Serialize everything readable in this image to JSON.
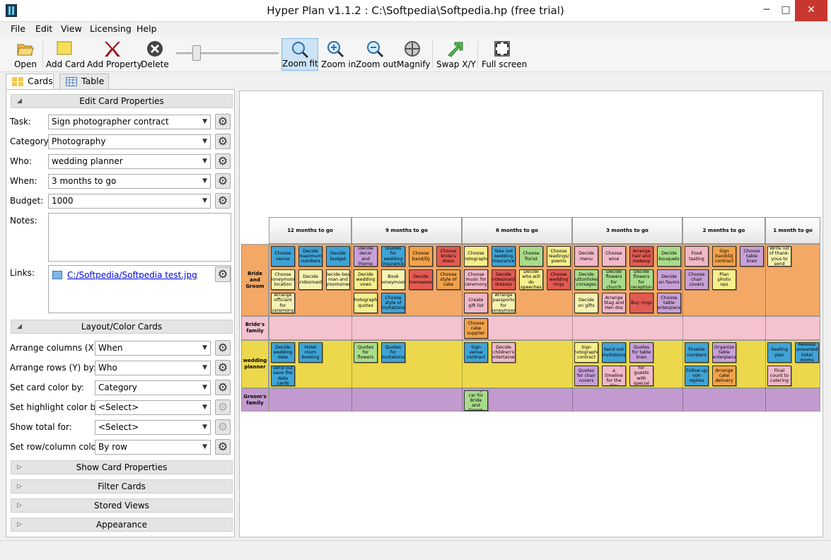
{
  "window": {
    "title": "Hyper Plan v1.1.2 : C:\\Softpedia\\Softpedia.hp (free trial)",
    "minimize": "─",
    "maximize": "□",
    "close": "✕"
  },
  "menu": [
    "File",
    "Edit",
    "View",
    "Licensing",
    "Help"
  ],
  "toolbar": {
    "open": "Open",
    "add_card": "Add Card",
    "add_property": "Add Property",
    "delete": "Delete",
    "zoom_fit": "Zoom fit",
    "zoom_in": "Zoom in",
    "zoom_out": "Zoom out",
    "magnify": "Magnify",
    "swap_xy": "Swap X/Y",
    "full_screen": "Full screen",
    "zoom_slider": 0.2
  },
  "tabs": {
    "cards": "Cards",
    "table": "Table"
  },
  "edit_card": {
    "header": "Edit Card Properties",
    "task_label": "Task:",
    "task": "Sign photographer contract",
    "category_label": "Category:",
    "category": "Photography",
    "who_label": "Who:",
    "who": "wedding planner",
    "when_label": "When:",
    "when": "3 months to go",
    "budget_label": "Budget:",
    "budget": "1000",
    "notes_label": "Notes:",
    "notes": "",
    "links_label": "Links:",
    "link": "C:/Softpedia/Softpedia test.jpg"
  },
  "layout": {
    "header": "Layout/Color Cards",
    "arrange_x_label": "Arrange columns (X) by:",
    "arrange_x": "When",
    "arrange_y_label": "Arrange rows (Y) by:",
    "arrange_y": "Who",
    "card_color_label": "Set card color by:",
    "card_color": "Category",
    "highlight_label": "Set highlight color by:",
    "highlight": "<Select>",
    "total_label": "Show total for:",
    "total": "<Select>",
    "rowcol_label": "Set row/column color:",
    "rowcol": "By row"
  },
  "sections": {
    "show_card": "Show Card Properties",
    "filter": "Filter Cards",
    "stored": "Stored Views",
    "appearance": "Appearance"
  },
  "colors": {
    "blue": "#3fa3d6",
    "pink": "#f0b8c8",
    "yellow": "#f5ef8c",
    "orange": "#f2a24a",
    "red": "#e35a52",
    "purple": "#c8a0d8",
    "green": "#a8dc8a",
    "cream": "#f7f2b0",
    "row_bg": [
      "#f3a866",
      "#f5c2d0",
      "#ecd84a",
      "#c39ad0"
    ]
  },
  "board": {
    "columns": [
      "12 months to go",
      "9 months to go",
      "6 months to go",
      "3 months to go",
      "2 months to go",
      "1 month to go"
    ],
    "rows": [
      "Bride and Groom",
      "Bride's family",
      "wedding planner",
      "Groom's family"
    ],
    "cards": [
      {
        "text": "Choose venue",
        "row": 0,
        "col": 0,
        "slot": 0,
        "line": 0,
        "color": "blue"
      },
      {
        "text": "Decide maximum numbers",
        "row": 0,
        "col": 0,
        "slot": 1,
        "line": 0,
        "color": "blue"
      },
      {
        "text": "Decide budget",
        "row": 0,
        "col": 0,
        "slot": 2,
        "line": 0,
        "color": "blue"
      },
      {
        "text": "Choose honeymoon location",
        "row": 0,
        "col": 0,
        "slot": 0,
        "line": 1,
        "color": "cream"
      },
      {
        "text": "Decide bridesmaids",
        "row": 0,
        "col": 0,
        "slot": 1,
        "line": 1,
        "color": "cream"
      },
      {
        "text": "Decide best man and groomsmen",
        "row": 0,
        "col": 0,
        "slot": 2,
        "line": 1,
        "color": "cream"
      },
      {
        "text": "Arrange officiant for ceremony",
        "row": 0,
        "col": 0,
        "slot": 0,
        "line": 2,
        "color": "cream"
      },
      {
        "text": "Decide decor and theme",
        "row": 0,
        "col": 1,
        "slot": 0,
        "line": 0,
        "color": "purple"
      },
      {
        "text": "Quotes for wedding insurance",
        "row": 0,
        "col": 1,
        "slot": 1,
        "line": 0,
        "color": "blue"
      },
      {
        "text": "Choose band/DJ",
        "row": 0,
        "col": 1,
        "slot": 2,
        "line": 0,
        "color": "orange"
      },
      {
        "text": "Choose bride's dress",
        "row": 0,
        "col": 1,
        "slot": 3,
        "line": 0,
        "color": "red"
      },
      {
        "text": "Decide wedding vows",
        "row": 0,
        "col": 1,
        "slot": 0,
        "line": 1,
        "color": "yellow"
      },
      {
        "text": "Book honeymoon",
        "row": 0,
        "col": 1,
        "slot": 1,
        "line": 1,
        "color": "cream"
      },
      {
        "text": "Decide menswear",
        "row": 0,
        "col": 1,
        "slot": 2,
        "line": 1,
        "color": "red"
      },
      {
        "text": "Choose style of cake",
        "row": 0,
        "col": 1,
        "slot": 3,
        "line": 1,
        "color": "orange"
      },
      {
        "text": "Photography quotes",
        "row": 0,
        "col": 1,
        "slot": 0,
        "line": 2,
        "color": "yellow"
      },
      {
        "text": "Choose style of invitations",
        "row": 0,
        "col": 1,
        "slot": 1,
        "line": 2,
        "color": "blue"
      },
      {
        "text": "Choose photographer",
        "row": 0,
        "col": 2,
        "slot": 0,
        "line": 0,
        "color": "yellow"
      },
      {
        "text": "Take out wedding insurance",
        "row": 0,
        "col": 2,
        "slot": 1,
        "line": 0,
        "color": "blue"
      },
      {
        "text": "Choose florist",
        "row": 0,
        "col": 2,
        "slot": 2,
        "line": 0,
        "color": "green"
      },
      {
        "text": "Choose readings/ poems",
        "row": 0,
        "col": 2,
        "slot": 3,
        "line": 0,
        "color": "yellow"
      },
      {
        "text": "Choose music for ceremony",
        "row": 0,
        "col": 2,
        "slot": 0,
        "line": 1,
        "color": "pink"
      },
      {
        "text": "Decide bridesmaids dresses",
        "row": 0,
        "col": 2,
        "slot": 1,
        "line": 1,
        "color": "red"
      },
      {
        "text": "Decide who will do speeches",
        "row": 0,
        "col": 2,
        "slot": 2,
        "line": 1,
        "color": "yellow"
      },
      {
        "text": "Choose wedding rings",
        "row": 0,
        "col": 2,
        "slot": 3,
        "line": 1,
        "color": "red"
      },
      {
        "text": "Create gift list",
        "row": 0,
        "col": 2,
        "slot": 0,
        "line": 2,
        "color": "pink"
      },
      {
        "text": "Arrange passports for honeymoon",
        "row": 0,
        "col": 2,
        "slot": 1,
        "line": 2,
        "color": "cream"
      },
      {
        "text": "Decide menu",
        "row": 0,
        "col": 3,
        "slot": 0,
        "line": 0,
        "color": "pink"
      },
      {
        "text": "Choose wine",
        "row": 0,
        "col": 3,
        "slot": 1,
        "line": 0,
        "color": "pink"
      },
      {
        "text": "Arrange hair and makeup",
        "row": 0,
        "col": 3,
        "slot": 2,
        "line": 0,
        "color": "red"
      },
      {
        "text": "Decide bouquets",
        "row": 0,
        "col": 3,
        "slot": 3,
        "line": 0,
        "color": "green"
      },
      {
        "text": "Decide buttonholes/ corsages",
        "row": 0,
        "col": 3,
        "slot": 0,
        "line": 1,
        "color": "green"
      },
      {
        "text": "Decide flowers for church",
        "row": 0,
        "col": 3,
        "slot": 1,
        "line": 1,
        "color": "green"
      },
      {
        "text": "Decide flowers for reception",
        "row": 0,
        "col": 3,
        "slot": 2,
        "line": 1,
        "color": "green"
      },
      {
        "text": "Decide on favors",
        "row": 0,
        "col": 3,
        "slot": 3,
        "line": 1,
        "color": "purple"
      },
      {
        "text": "Decide on gifts",
        "row": 0,
        "col": 3,
        "slot": 0,
        "line": 2,
        "color": "cream"
      },
      {
        "text": "Arrange Stag and Hen dos",
        "row": 0,
        "col": 3,
        "slot": 1,
        "line": 2,
        "color": "pink"
      },
      {
        "text": "Buy rings",
        "row": 0,
        "col": 3,
        "slot": 2,
        "line": 2,
        "color": "red"
      },
      {
        "text": "Choose table centerpieces",
        "row": 0,
        "col": 3,
        "slot": 3,
        "line": 2,
        "color": "purple"
      },
      {
        "text": "Food tasting",
        "row": 0,
        "col": 4,
        "slot": 0,
        "line": 0,
        "color": "pink"
      },
      {
        "text": "Sign band/DJ contract",
        "row": 0,
        "col": 4,
        "slot": 1,
        "line": 0,
        "color": "orange"
      },
      {
        "text": "Choose table linen",
        "row": 0,
        "col": 4,
        "slot": 2,
        "line": 0,
        "color": "purple"
      },
      {
        "text": "Choose chair covers",
        "row": 0,
        "col": 4,
        "slot": 0,
        "line": 1,
        "color": "purple"
      },
      {
        "text": "Plan photo ops",
        "row": 0,
        "col": 4,
        "slot": 1,
        "line": 1,
        "color": "yellow"
      },
      {
        "text": "Write list of thank-yous to send",
        "row": 0,
        "col": 5,
        "slot": 0,
        "line": 0,
        "color": "cream"
      },
      {
        "text": "Choose cake supplier",
        "row": 1,
        "col": 2,
        "slot": 0,
        "line": 0,
        "color": "orange"
      },
      {
        "text": "Decide wedding date",
        "row": 2,
        "col": 0,
        "slot": 0,
        "line": 0,
        "color": "blue"
      },
      {
        "text": "Hotel room booking",
        "row": 2,
        "col": 0,
        "slot": 1,
        "line": 0,
        "color": "blue"
      },
      {
        "text": "Send out save the date cards",
        "row": 2,
        "col": 0,
        "slot": 0,
        "line": 1,
        "color": "blue"
      },
      {
        "text": "Quotes for flowers",
        "row": 2,
        "col": 1,
        "slot": 0,
        "line": 0,
        "color": "green"
      },
      {
        "text": "Quotes for invitations",
        "row": 2,
        "col": 1,
        "slot": 1,
        "line": 0,
        "color": "blue"
      },
      {
        "text": "Sign venue contract",
        "row": 2,
        "col": 2,
        "slot": 0,
        "line": 0,
        "color": "blue"
      },
      {
        "text": "Decide children's entertainer",
        "row": 2,
        "col": 2,
        "slot": 1,
        "line": 0,
        "color": "pink"
      },
      {
        "text": "Sign photographer contract",
        "row": 2,
        "col": 3,
        "slot": 0,
        "line": 0,
        "color": "yellow"
      },
      {
        "text": "Send out invitations",
        "row": 2,
        "col": 3,
        "slot": 1,
        "line": 0,
        "color": "blue"
      },
      {
        "text": "Quotes for table linen",
        "row": 2,
        "col": 3,
        "slot": 2,
        "line": 0,
        "color": "purple"
      },
      {
        "text": "Quotes for chair covers",
        "row": 2,
        "col": 3,
        "slot": 0,
        "line": 1,
        "color": "purple"
      },
      {
        "text": "Draw up a timeline for the day",
        "row": 2,
        "col": 3,
        "slot": 1,
        "line": 1,
        "color": "pink"
      },
      {
        "text": "Check for guests with special diets",
        "row": 2,
        "col": 3,
        "slot": 2,
        "line": 1,
        "color": "pink"
      },
      {
        "text": "Finalize numbers",
        "row": 2,
        "col": 4,
        "slot": 0,
        "line": 0,
        "color": "blue"
      },
      {
        "text": "Organize table centerpieces",
        "row": 2,
        "col": 4,
        "slot": 1,
        "line": 0,
        "color": "purple"
      },
      {
        "text": "Follow up non replies",
        "row": 2,
        "col": 4,
        "slot": 0,
        "line": 1,
        "color": "blue"
      },
      {
        "text": "Arrange cake delivery",
        "row": 2,
        "col": 4,
        "slot": 1,
        "line": 1,
        "color": "orange"
      },
      {
        "text": "Seating plan",
        "row": 2,
        "col": 5,
        "slot": 0,
        "line": 0,
        "color": "blue"
      },
      {
        "text": "Release unwanted hotel rooms",
        "row": 2,
        "col": 5,
        "slot": 1,
        "line": 0,
        "color": "blue"
      },
      {
        "text": "Final count to catering",
        "row": 2,
        "col": 5,
        "slot": 0,
        "line": 1,
        "color": "pink"
      },
      {
        "text": "Arrange car for Bride and Groom",
        "row": 3,
        "col": 2,
        "slot": 0,
        "line": 0,
        "color": "green"
      }
    ]
  }
}
